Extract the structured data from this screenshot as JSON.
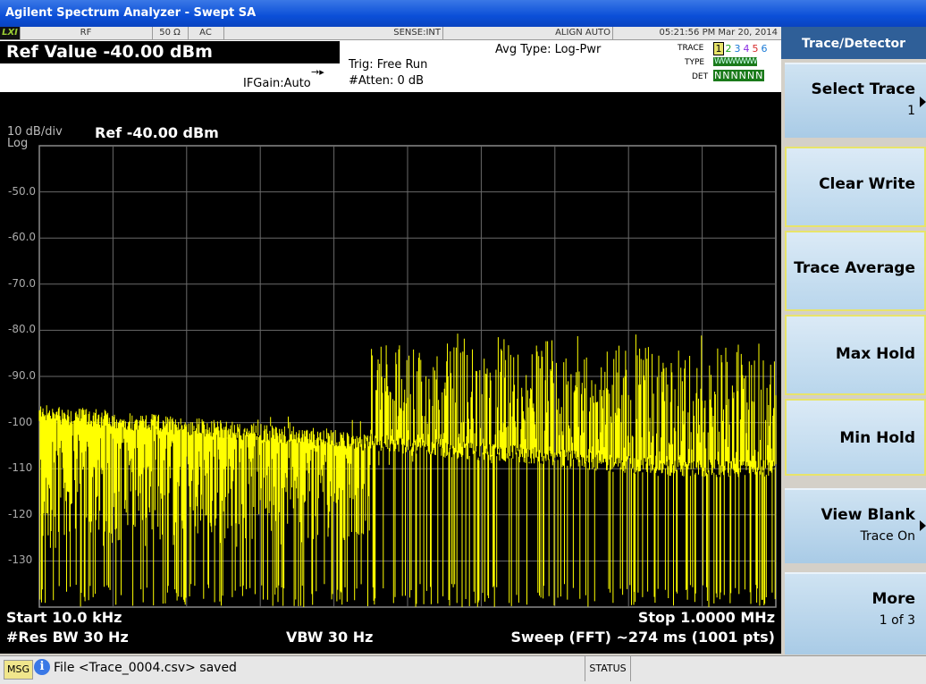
{
  "window": {
    "title": "Agilent Spectrum Analyzer - Swept SA"
  },
  "status_strip": {
    "lxi": "LXI",
    "rf": "RF",
    "impedance": "50 Ω",
    "coupling": "AC",
    "sense": "SENSE:INT",
    "align": "ALIGN AUTO",
    "datetime": "05:21:56 PM Mar 20, 2014"
  },
  "header": {
    "ref_value": "Ref Value -40.00 dBm",
    "ifgain": "IFGain:Auto",
    "trig": "Trig: Free Run",
    "atten": "#Atten: 0 dB",
    "avg_type": "Avg Type: Log-Pwr"
  },
  "trace_legend": {
    "trace_label": "TRACE",
    "type_label": "TYPE",
    "det_label": "DET",
    "numbers": [
      "1",
      "2",
      "3",
      "4",
      "5",
      "6"
    ],
    "number_colors": [
      "#000000",
      "#1aa51a",
      "#1a7ad6",
      "#8a2be2",
      "#d62a2a",
      "#1a7ad6"
    ],
    "types": "WWWWWW",
    "dets": "NNNNNN"
  },
  "plot": {
    "scale": "10 dB/div",
    "scale_type": "Log",
    "ref": "Ref -40.00 dBm",
    "y_ticks": [
      "-50.0",
      "-60.0",
      "-70.0",
      "-80.0",
      "-90.0",
      "-100",
      "-110",
      "-120",
      "-130"
    ],
    "trace_color": "#ffff00"
  },
  "footer": {
    "start": "Start 10.0 kHz",
    "stop": "Stop 1.0000 MHz",
    "res_bw": "#Res BW 30 Hz",
    "vbw": "VBW 30 Hz",
    "sweep": "Sweep (FFT)  ~274 ms (1001 pts)"
  },
  "panel": {
    "title": "Trace/Detector",
    "select_trace": "Select Trace",
    "select_trace_value": "1",
    "clear_write": "Clear Write",
    "trace_average": "Trace Average",
    "max_hold": "Max Hold",
    "min_hold": "Min Hold",
    "view_blank": "View Blank",
    "view_blank_value": "Trace On",
    "more": "More",
    "more_value": "1 of 3"
  },
  "message_bar": {
    "msg_label": "MSG",
    "message": "File <Trace_0004.csv> saved",
    "status_label": "STATUS"
  }
}
